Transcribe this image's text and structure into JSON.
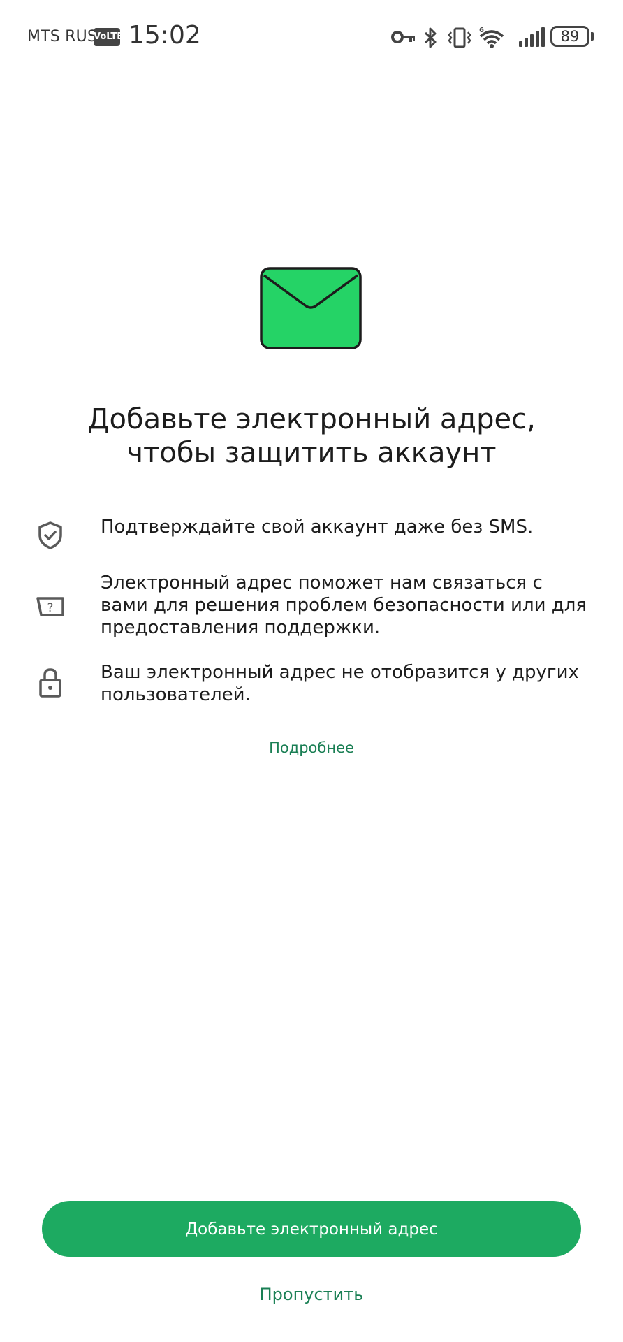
{
  "status_bar": {
    "carrier": "MTS RUS",
    "volte": "VoLTE",
    "time": "15:02",
    "battery": "89",
    "icons": [
      "vpn-key-icon",
      "bluetooth-icon",
      "vibrate-icon",
      "wifi-6-icon",
      "signal-icon",
      "battery-icon"
    ]
  },
  "hero": {
    "icon": "envelope-icon",
    "icon_color": "#25d366"
  },
  "title": "Добавьте электронный адрес, чтобы защитить аккаунт",
  "features": [
    {
      "icon": "shield-check-icon",
      "text": "Подтверждайте свой аккаунт даже без SMS."
    },
    {
      "icon": "help-chat-icon",
      "text": "Электронный адрес поможет нам связаться с вами для решения проблем безопасности или для предоставления поддержки."
    },
    {
      "icon": "lock-icon",
      "text": "Ваш электронный адрес не отобразится у других пользователей."
    }
  ],
  "more_link": "Подробнее",
  "primary_button": "Добавьте электронный адрес",
  "skip_button": "Пропустить",
  "colors": {
    "accent": "#1daa61",
    "link": "#1a7f54",
    "envelope": "#25d366"
  }
}
